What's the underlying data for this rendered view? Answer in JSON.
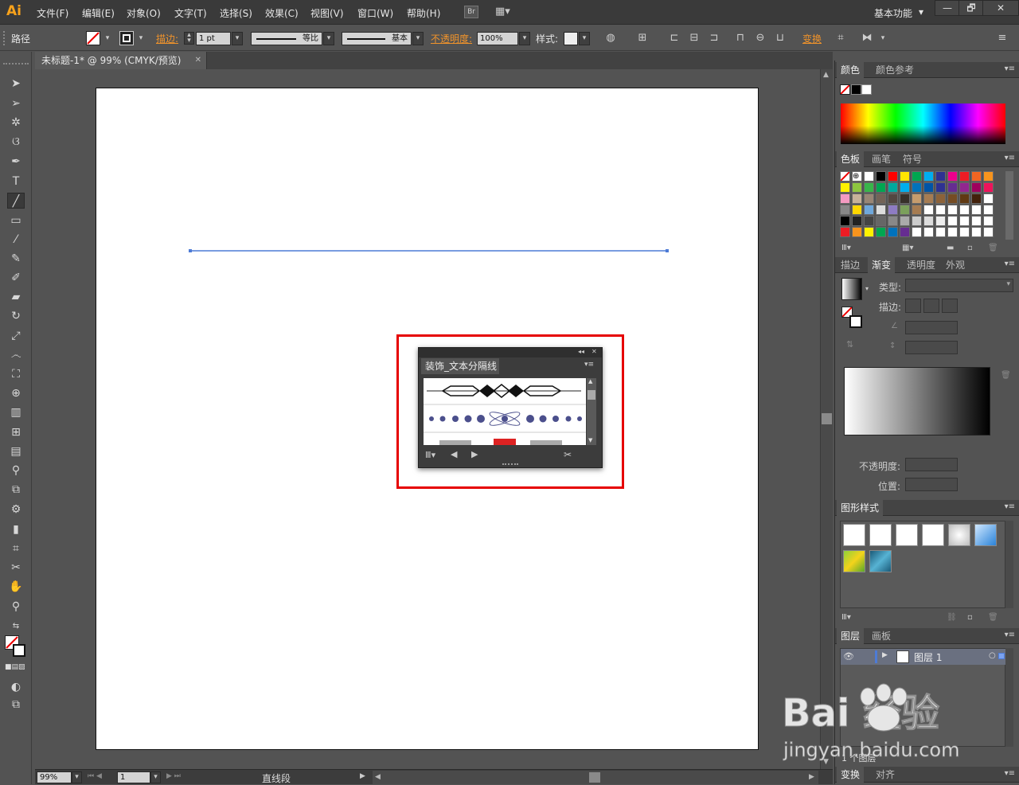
{
  "app": {
    "logo": "Ai"
  },
  "menu": [
    "文件(F)",
    "编辑(E)",
    "对象(O)",
    "文字(T)",
    "选择(S)",
    "效果(C)",
    "视图(V)",
    "窗口(W)",
    "帮助(H)"
  ],
  "menubar": {
    "bridge": "Br",
    "workspace": "基本功能",
    "workspace_arrow": "▾",
    "minimize": "—",
    "restore": "🗗",
    "close": "✕"
  },
  "control": {
    "object_type": "路径",
    "stroke_label": "描边:",
    "stroke_value": "1 pt",
    "profile": "等比",
    "brush": "基本",
    "opacity_label": "不透明度:",
    "opacity_value": "100%",
    "style_label": "样式:",
    "transform": "变换"
  },
  "document": {
    "tab_title": "未标题-1* @ 99% (CMYK/预览)",
    "tab_close": "✕"
  },
  "status": {
    "zoom": "99%",
    "page": "1",
    "tool": "直线段"
  },
  "floating_panel": {
    "title": "装饰_文本分隔线",
    "collapse": "◂◂",
    "close": "✕",
    "menu": "▾≡"
  },
  "panels": {
    "color": {
      "tabs": [
        "颜色",
        "颜色参考"
      ]
    },
    "swatches": {
      "tabs": [
        "色板",
        "画笔",
        "符号"
      ]
    },
    "gradient": {
      "tabs": [
        "描边",
        "渐变",
        "透明度",
        "外观"
      ],
      "type_label": "类型:",
      "stroke_label": "描边:",
      "opacity_label": "不透明度:",
      "position_label": "位置:"
    },
    "graphic_styles": {
      "tabs": [
        "图形样式"
      ]
    },
    "layers": {
      "tabs": [
        "图层",
        "画板"
      ],
      "layer_name": "图层 1",
      "footer": "1 个图层"
    },
    "transform": {
      "tabs": [
        "变换",
        "对齐"
      ]
    }
  },
  "watermark": {
    "text": "Bai 经验",
    "url": "jingyan.baidu.com"
  },
  "colors": {
    "accent": "#f7a21b",
    "selection": "#4d7bd6",
    "highlight": "#e60000"
  }
}
